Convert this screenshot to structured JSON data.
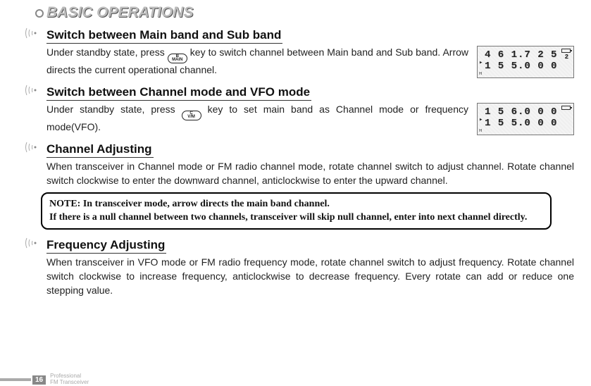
{
  "chapter_title": "BASIC OPERATIONS",
  "sections": {
    "s1": {
      "title": "Switch between Main band and Sub band",
      "body_a": "Under standby state, press ",
      "body_b": " key to switch channel between Main band and Sub band. Arrow directs the current operational channel.",
      "key_top": "B",
      "key_bot": "MAIN",
      "lcd_line1": "4 6 1.7 2 5",
      "lcd_ch": "2",
      "lcd_line2": "1 5 5.0 0 0"
    },
    "s2": {
      "title": "Switch between Channel mode and VFO mode",
      "body_a": "Under standby state, press ",
      "body_b": " key to set main band as Channel mode or  frequency mode(VFO).",
      "key_top": "C",
      "key_bot": "V/M",
      "lcd_line1": "1 5 6.0 0 0",
      "lcd_line2": "1 5 5.0 0 0"
    },
    "s3": {
      "title": "Channel Adjusting",
      "body": "When transceiver in Channel mode or FM radio channel mode, rotate channel switch to adjust channel. Rotate channel switch clockwise to enter the downward channel, anticlockwise to enter the upward channel."
    },
    "note_line1": "NOTE: In transceiver mode, arrow directs the main band channel.",
    "note_line2": "If there is a null channel between two channels, transceiver will skip null channel, enter into next channel directly.",
    "s4": {
      "title": "Frequency Adjusting",
      "body": "When transceiver in VFO mode or FM radio frequency mode, rotate channel switch to adjust frequency. Rotate channel switch clockwise to increase frequency, anticlockwise to decrease frequency. Every rotate can add or reduce one stepping value."
    }
  },
  "footer": {
    "page": "16",
    "line1": "Professional",
    "line2": "FM Transceiver"
  }
}
